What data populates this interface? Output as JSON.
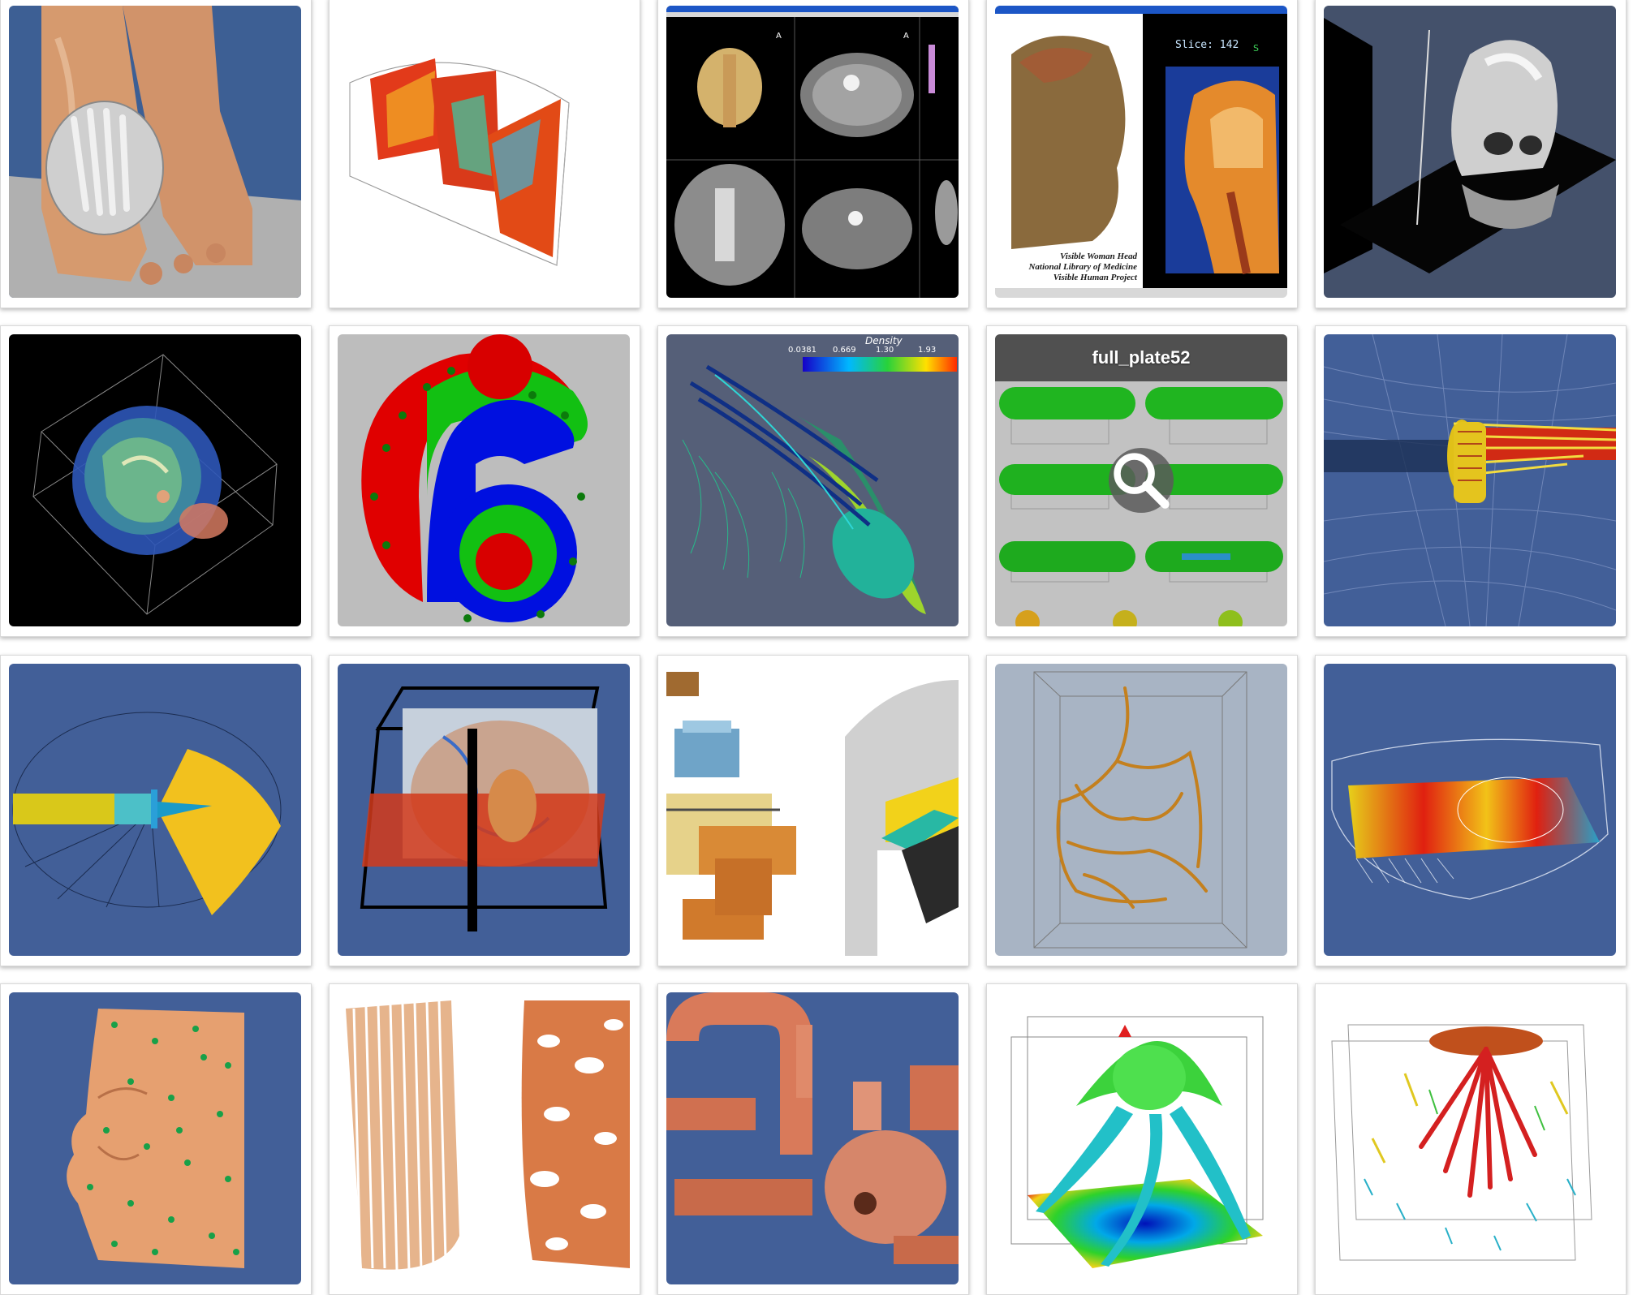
{
  "gallery": {
    "tiles": [
      {
        "subject": "foot-xray-cutaway"
      },
      {
        "subject": "wedge-slices"
      },
      {
        "subject": "ct-viewer",
        "annotations": {
          "left_panel_label": "A",
          "right_panel_label": "A"
        }
      },
      {
        "subject": "visible-woman-head",
        "caption_lines": [
          "Visible Woman Head",
          "National Library of Medicine",
          "Visible Human Project"
        ],
        "slice_label": "Slice: 142",
        "side_label": "S"
      },
      {
        "subject": "skull-planes"
      },
      {
        "subject": "brain-volume-box"
      },
      {
        "subject": "number-six-surface"
      },
      {
        "subject": "space-shuttle-flow",
        "colorbar": {
          "title": "Density",
          "ticks": [
            "0.0381",
            "0.669",
            "1.30",
            "1.93"
          ]
        }
      },
      {
        "subject": "full-plate-grid",
        "hover_title": "full_plate52",
        "zoom_icon": "magnifier-icon"
      },
      {
        "subject": "streamline-tube"
      },
      {
        "subject": "half-disk-flow"
      },
      {
        "subject": "head-orthogonal-slices"
      },
      {
        "subject": "engine-cutaway"
      },
      {
        "subject": "vascular-tree"
      },
      {
        "subject": "fan-slice-heatmap"
      },
      {
        "subject": "face-points"
      },
      {
        "subject": "face-contour-stripes"
      },
      {
        "subject": "copper-pipes"
      },
      {
        "subject": "tentacle-surface"
      },
      {
        "subject": "vector-glyphs"
      }
    ]
  }
}
